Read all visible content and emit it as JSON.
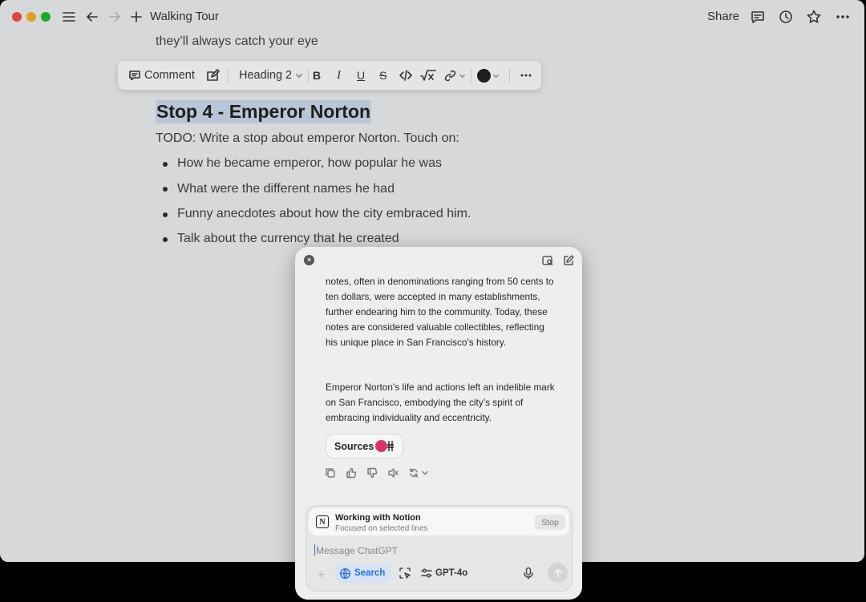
{
  "titlebar": {
    "title": "Walking Tour",
    "share_label": "Share"
  },
  "document": {
    "preceding_line": "they’ll always catch your eye",
    "heading": "Stop 4 - Emperor Norton",
    "todo": "TODO: Write a stop about emperor Norton. Touch on:",
    "bullets": [
      "How he became emperor, how popular he was",
      "What were the different names he had",
      "Funny anecdotes about how the city embraced him.",
      "Talk about the currency that he created"
    ]
  },
  "format_bar": {
    "comment_label": "Comment",
    "block_type": "Heading 2",
    "text_color": "#1e1e1e"
  },
  "chat": {
    "paragraph_1": "notes, often in denominations ranging from 50 cents to ten dollars, were accepted in many establishments, further endearing him to the community. Today, these notes are considered valuable collectibles, reflecting his unique place in San Francisco’s history.",
    "paragraph_2": "Emperor Norton’s life and actions left an indelible mark on San Francisco, embodying the city’s spirit of embracing individuality and eccentricity.",
    "sources_label": "Sources",
    "context_title": "Working with Notion",
    "context_subtitle": "Focused on selected lines",
    "stop_label": "Stop",
    "input_placeholder": "Message ChatGPT",
    "search_label": "Search",
    "model_label": "GPT-4o"
  },
  "colors": {
    "selection_highlight": "#b8c6d6",
    "search_accent": "#2a6fdb",
    "source_favicon": "#d8326b"
  }
}
